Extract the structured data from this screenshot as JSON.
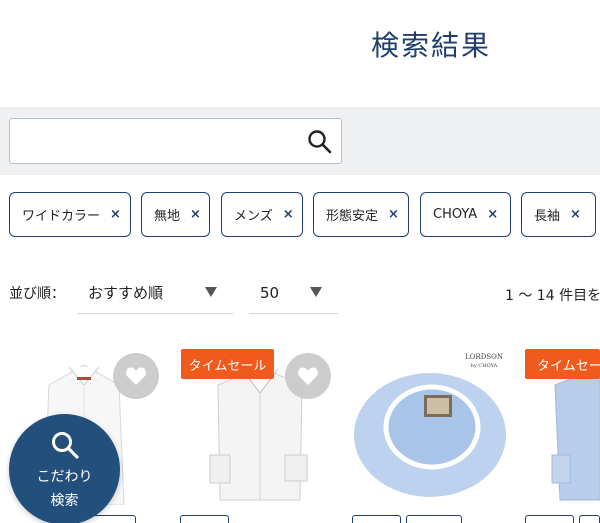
{
  "header": {
    "title": "検索結果"
  },
  "search": {
    "placeholder": "",
    "value": ""
  },
  "filters": [
    {
      "label": "ワイドカラー",
      "remove": "×"
    },
    {
      "label": "無地",
      "remove": "×"
    },
    {
      "label": "メンズ",
      "remove": "×"
    },
    {
      "label": "形態安定",
      "remove": "×"
    },
    {
      "label": "CHOYA",
      "remove": "×"
    },
    {
      "label": "長袖",
      "remove": "×"
    }
  ],
  "sort": {
    "label": "並び順：",
    "order_value": "おすすめ順",
    "per_page_value": "50",
    "result_text": "1 〜 14 件目を"
  },
  "products": [
    {
      "badge": "",
      "favorite_icon": "heart-icon"
    },
    {
      "badge": "タイムセール",
      "favorite_icon": "heart-icon"
    },
    {
      "badge": "",
      "brand_logo": "LORDSON by CHOYA"
    },
    {
      "badge": "タイムセール"
    }
  ],
  "fab": {
    "line1": "こだわり",
    "line2": "検索",
    "icon": "search-icon"
  },
  "colors": {
    "accent": "#1f3f6e",
    "sale": "#f05a1c",
    "fab": "#234f7d",
    "band": "#eef0f1"
  }
}
